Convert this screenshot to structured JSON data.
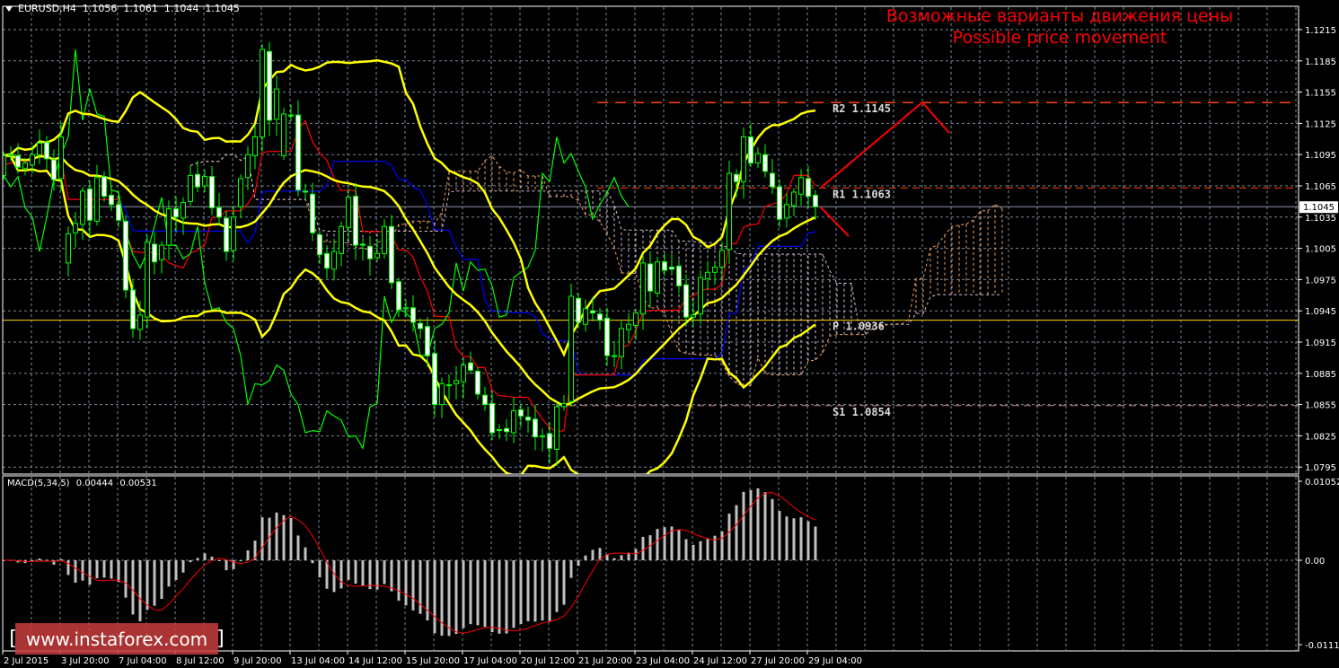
{
  "header": {
    "symbol_timeframe": "EURUSD,H4",
    "open": "1.1056",
    "high": "1.1061",
    "low": "1.1044",
    "close": "1.1045"
  },
  "annotation": {
    "line1": "Возможные варианты движения цены",
    "line2": "Possible price movement"
  },
  "levels": [
    {
      "label": "R2",
      "value": 1.1145,
      "text": "R2 1.1145",
      "color": "#ff4500"
    },
    {
      "label": "R1",
      "value": 1.1063,
      "text": "R1 1.1063",
      "color": "#ff4500"
    },
    {
      "label": "P",
      "value": 1.0936,
      "text": "P 1.0936",
      "color": "#ffd700"
    },
    {
      "label": "S1",
      "value": 1.0854,
      "text": "S1 1.0854",
      "color": "#c08080"
    }
  ],
  "macd": {
    "label": "MACD(5,34,5)",
    "main": "0.00444",
    "signal": "0.00531",
    "axis_labels": [
      "0.01052",
      "0.00",
      "-0.01115"
    ]
  },
  "watermark": {
    "open_bracket": "[",
    "text": "www.instaforex.com",
    "close_bracket": "]"
  },
  "colors": {
    "background": "#000000",
    "bull_body": "#000000",
    "bear_body": "#ffffff",
    "candle_outline": "#00ff00",
    "bollinger": "#ffff00",
    "tenkan": "#ff0000",
    "kijun": "#0000ff",
    "chikou": "#00ff00",
    "cloud_up": "#f4a460",
    "cloud_down": "#d8bfd8",
    "macd_hist": "#c0c0c0",
    "macd_signal": "#ff0000",
    "grid": "#778899",
    "forecast_arrow": "#ff0000"
  },
  "chart_data": {
    "type": "candlestick",
    "symbol": "EURUSD",
    "timeframe": "H4",
    "current_price": "1.1045",
    "price_axis": [
      "1.1215",
      "1.1185",
      "1.1155",
      "1.1125",
      "1.1095",
      "1.1065",
      "1.1035",
      "1.1005",
      "1.0975",
      "1.0945",
      "1.0915",
      "1.0885",
      "1.0855",
      "1.0825",
      "1.0795"
    ],
    "ylim": [
      1.0795,
      1.1215
    ],
    "time_labels": [
      "2 Jul 2015",
      "3 Jul 20:00",
      "7 Jul 04:00",
      "8 Jul 12:00",
      "9 Jul 20:00",
      "13 Jul 04:00",
      "14 Jul 12:00",
      "15 Jul 20:00",
      "17 Jul 04:00",
      "20 Jul 12:00",
      "21 Jul 20:00",
      "23 Jul 04:00",
      "24 Jul 12:00",
      "27 Jul 20:00",
      "29 Jul 04:00"
    ],
    "open": [
      1.1075,
      1.1094,
      1.1094,
      1.1082,
      1.1085,
      1.1095,
      1.1107,
      1.109,
      1.1072,
      1.0991,
      1.102,
      1.1028,
      1.1062,
      1.1031,
      1.1074,
      1.1056,
      1.1047,
      1.1031,
      1.0965,
      1.0927,
      1.0939,
      1.1009,
      1.0994,
      1.1008,
      1.1043,
      1.1034,
      1.105,
      1.1076,
      1.1065,
      1.1074,
      1.1044,
      1.1034,
      1.1003,
      1.1045,
      1.1073,
      1.1094,
      1.1112,
      1.1194,
      1.1129,
      1.1094,
      1.1133,
      1.1133,
      1.106,
      1.1057,
      1.1018,
      1.1,
      1.0985,
      1.1,
      1.1025,
      1.1055,
      1.1009,
      1.1007,
      1.0996,
      1.1,
      1.1026,
      1.0973,
      1.0947,
      1.0948,
      1.0933,
      1.093,
      1.0904,
      1.0855,
      1.0874,
      1.0875,
      1.0877,
      1.0895,
      1.0887,
      1.0864,
      1.0856,
      1.0831,
      1.0832,
      1.0828,
      1.085,
      1.0843,
      1.0841,
      1.0824,
      1.0827,
      1.0812,
      1.0853,
      1.0858,
      1.0957,
      1.0932,
      1.0945,
      1.0942,
      1.0938,
      1.0902,
      1.0901,
      1.0927,
      1.0931,
      1.0942,
      1.099,
      1.0962,
      1.0992,
      1.0987,
      1.0988,
      1.097,
      1.0939,
      1.0942,
      1.0976,
      1.0982,
      1.0987,
      1.1004,
      1.1076,
      1.1069,
      1.1112,
      1.1087,
      1.1095,
      1.1077,
      1.1064,
      1.1034,
      1.1046,
      1.1057,
      1.1072,
      1.1056
    ],
    "close": [
      1.1094,
      1.1095,
      1.1083,
      1.1087,
      1.1095,
      1.1106,
      1.1091,
      1.1071,
      1.1112,
      1.1019,
      1.1029,
      1.106,
      1.1032,
      1.1073,
      1.1055,
      1.1047,
      1.1032,
      1.0965,
      1.0928,
      1.0941,
      1.1011,
      1.0992,
      1.1008,
      1.1043,
      1.1035,
      1.1049,
      1.1075,
      1.1064,
      1.1074,
      1.1044,
      1.1035,
      1.1002,
      1.1035,
      1.1072,
      1.1095,
      1.1112,
      1.1196,
      1.1128,
      1.1158,
      1.1134,
      1.1132,
      1.1061,
      1.1059,
      1.102,
      1.0999,
      1.0986,
      1.1002,
      1.1026,
      1.1054,
      1.1008,
      1.1008,
      1.0995,
      1.1,
      1.1026,
      1.0972,
      1.0946,
      1.0948,
      1.0934,
      1.0928,
      1.0902,
      1.0855,
      1.0875,
      1.0874,
      1.0878,
      1.0893,
      1.0888,
      1.0865,
      1.0855,
      1.0828,
      1.083,
      1.0829,
      1.0849,
      1.0844,
      1.084,
      1.0824,
      1.0825,
      1.0813,
      1.0853,
      1.0856,
      1.0959,
      1.0934,
      1.0947,
      1.0943,
      1.0936,
      1.0902,
      1.0902,
      1.0928,
      1.0932,
      1.0943,
      1.0991,
      1.0964,
      1.0992,
      1.0984,
      1.0985,
      1.0969,
      1.0939,
      1.0941,
      1.0977,
      1.0982,
      1.0987,
      1.1003,
      1.1077,
      1.1069,
      1.1112,
      1.1087,
      1.1096,
      1.1079,
      1.1064,
      1.1033,
      1.1047,
      1.1059,
      1.1073,
      1.1055,
      1.1045
    ],
    "indicators": [
      "Bollinger Bands",
      "Ichimoku",
      "MACD(5,34,5)"
    ]
  }
}
